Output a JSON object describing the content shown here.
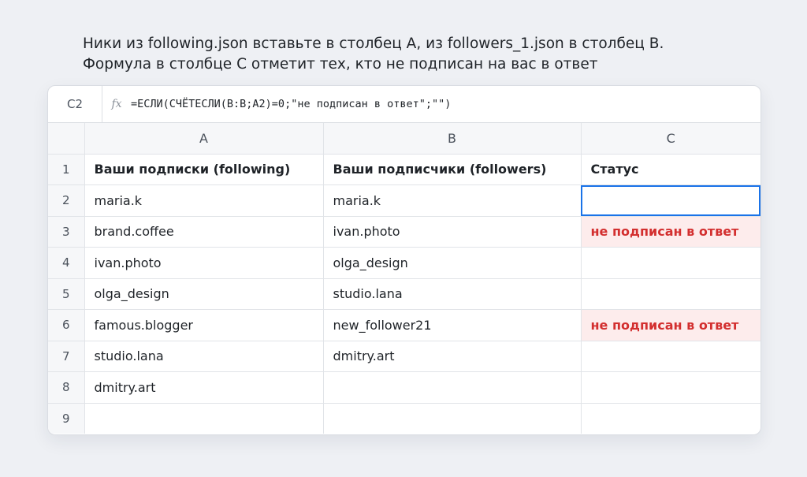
{
  "instruction": "Ники из following.json вставьте в столбец A, из followers_1.json в столбец B. Формула в столбце C отметит тех, кто не подписан на вас в ответ",
  "formula_bar": {
    "cell_ref": "C2",
    "fx_label": "fx",
    "formula": "=ЕСЛИ(СЧЁТЕСЛИ(B:B;A2)=0;\"не подписан в ответ\";\"\")"
  },
  "columns": [
    "A",
    "B",
    "C"
  ],
  "rows": [
    {
      "num": "1",
      "a": "Ваши подписки (following)",
      "b": "Ваши подписчики (followers)",
      "c": "Статус"
    },
    {
      "num": "2",
      "a": "maria.k",
      "b": "maria.k",
      "c": ""
    },
    {
      "num": "3",
      "a": "brand.coffee",
      "b": "ivan.photo",
      "c": "не подписан в ответ"
    },
    {
      "num": "4",
      "a": "ivan.photo",
      "b": "olga_design",
      "c": ""
    },
    {
      "num": "5",
      "a": "olga_design",
      "b": "studio.lana",
      "c": ""
    },
    {
      "num": "6",
      "a": "famous.blogger",
      "b": "new_follower21",
      "c": "не подписан в ответ"
    },
    {
      "num": "7",
      "a": "studio.lana",
      "b": "dmitry.art",
      "c": ""
    },
    {
      "num": "8",
      "a": "dmitry.art",
      "b": "",
      "c": ""
    },
    {
      "num": "9",
      "a": "",
      "b": "",
      "c": ""
    }
  ],
  "colors": {
    "selection": "#1a73e8",
    "alert_text": "#d32f2f",
    "alert_background": "#fdecec"
  }
}
